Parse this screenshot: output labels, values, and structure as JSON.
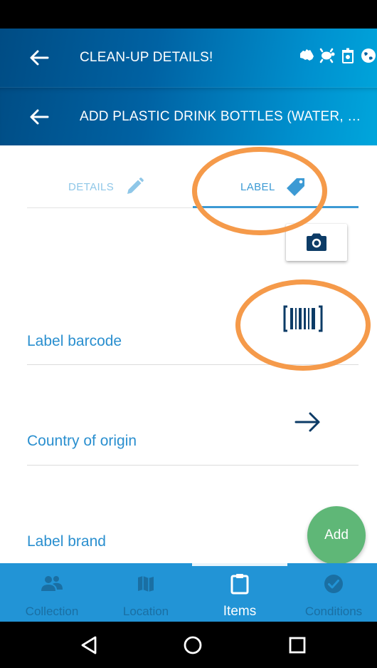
{
  "header": {
    "title": "CLEAN-UP DETAILS!",
    "subtitle": "ADD PLASTIC DRINK BOTTLES (WATER, JUICE, SOFT DRINK)",
    "icons": [
      "australia-icon",
      "turtle-icon",
      "bin-icon",
      "globe-icon"
    ]
  },
  "tabs": [
    {
      "label": "DETAILS",
      "icon": "pencil-icon",
      "active": false
    },
    {
      "label": "LABEL",
      "icon": "tag-icon",
      "active": true
    }
  ],
  "fields": {
    "barcode": "Label barcode",
    "country": "Country of origin",
    "brand": "Label brand"
  },
  "fab": {
    "label": "Add"
  },
  "bottom_nav": [
    {
      "label": "Collection",
      "icon": "people-icon",
      "active": false
    },
    {
      "label": "Location",
      "icon": "map-icon",
      "active": false
    },
    {
      "label": "Items",
      "icon": "clipboard-icon",
      "active": true
    },
    {
      "label": "Conditions",
      "icon": "check-circle-icon",
      "active": false
    }
  ],
  "colors": {
    "header_dark": "#004c84",
    "header_light": "#00a6dc",
    "accent_blue": "#2a8fcf",
    "nav_blue": "#2294d6",
    "fab_green": "#5fb777",
    "annotation_orange": "#f59a4a",
    "icon_navy": "#0c3b66"
  }
}
